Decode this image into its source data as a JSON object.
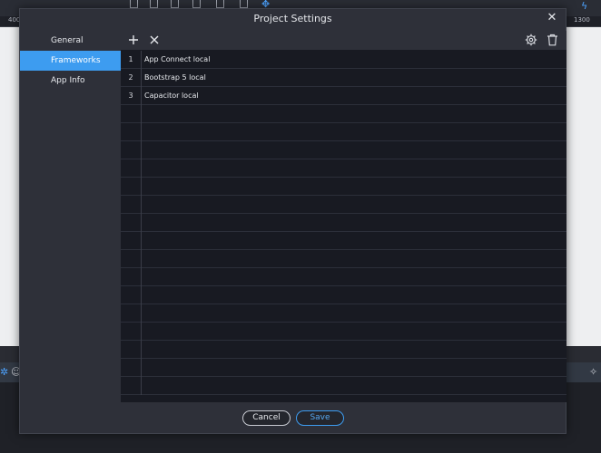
{
  "background": {
    "ruler_left": "400",
    "ruler_right": "1300",
    "bottom_text": "-- -- --"
  },
  "dialog": {
    "title": "Project Settings",
    "close_glyph": "✕"
  },
  "sidebar": {
    "items": [
      {
        "label": "General",
        "active": false
      },
      {
        "label": "Frameworks",
        "active": true
      },
      {
        "label": "App Info",
        "active": false
      }
    ]
  },
  "toolbar": {
    "add_icon": "plus-icon",
    "remove_icon": "close-icon",
    "settings_icon": "gear-icon",
    "delete_icon": "trash-icon"
  },
  "frameworks": {
    "rows": [
      {
        "index": "1",
        "name": "App Connect local"
      },
      {
        "index": "2",
        "name": "Bootstrap 5 local"
      },
      {
        "index": "3",
        "name": "Capacitor local"
      },
      {
        "index": "",
        "name": ""
      },
      {
        "index": "",
        "name": ""
      },
      {
        "index": "",
        "name": ""
      },
      {
        "index": "",
        "name": ""
      },
      {
        "index": "",
        "name": ""
      },
      {
        "index": "",
        "name": ""
      },
      {
        "index": "",
        "name": ""
      },
      {
        "index": "",
        "name": ""
      },
      {
        "index": "",
        "name": ""
      },
      {
        "index": "",
        "name": ""
      },
      {
        "index": "",
        "name": ""
      },
      {
        "index": "",
        "name": ""
      },
      {
        "index": "",
        "name": ""
      },
      {
        "index": "",
        "name": ""
      },
      {
        "index": "",
        "name": ""
      },
      {
        "index": "",
        "name": ""
      }
    ]
  },
  "footer": {
    "cancel_label": "Cancel",
    "save_label": "Save"
  },
  "colors": {
    "accent": "#3d9cf0",
    "dialog_bg": "#2e3039",
    "grid_bg": "#181a22"
  }
}
